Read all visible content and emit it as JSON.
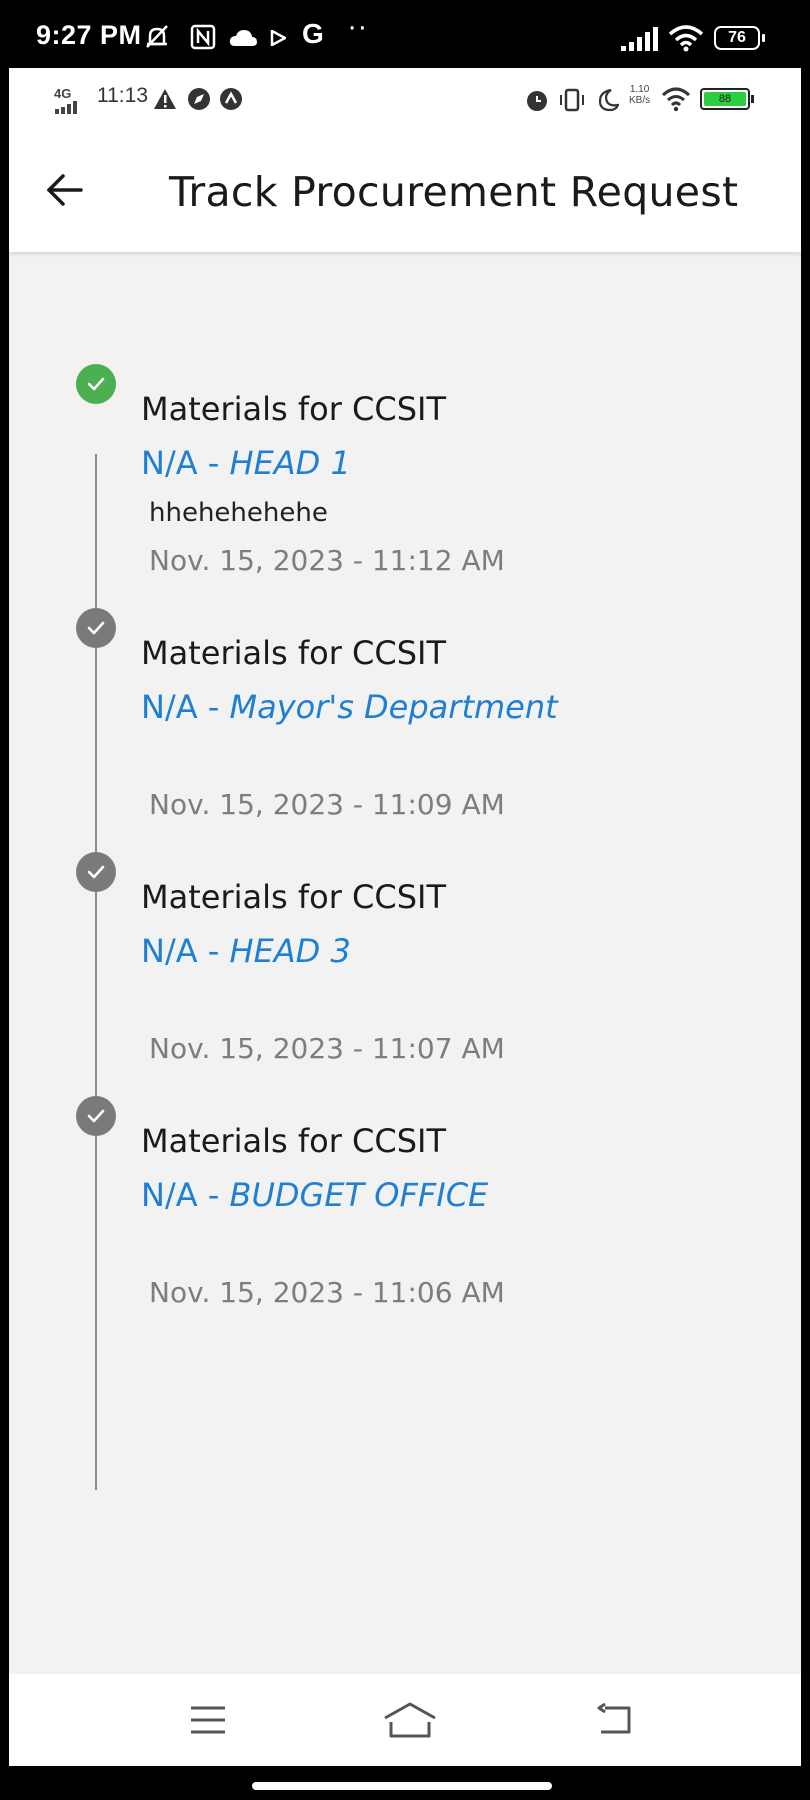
{
  "outer_status": {
    "time": "9:27 PM",
    "g_label": "G",
    "more": "··",
    "battery": "76"
  },
  "inner_status": {
    "network": "4G",
    "time": "11:13",
    "speed_value": "1.10",
    "speed_unit": "KB/s",
    "battery": "88"
  },
  "header": {
    "title": "Track Procurement Request"
  },
  "timeline": [
    {
      "title": "Materials for CCSIT",
      "code": "N/A - ",
      "office": "HEAD 1",
      "remark": "hhehehehehe",
      "date": "Nov. 15, 2023 - 11:12 AM",
      "state": "current",
      "dot_color": "#4caf50"
    },
    {
      "title": "Materials for CCSIT",
      "code": "N/A - ",
      "office": "Mayor's Department",
      "remark": "",
      "date": "Nov. 15, 2023 - 11:09 AM",
      "state": "done",
      "dot_color": "#7a7a7a"
    },
    {
      "title": "Materials for CCSIT",
      "code": "N/A - ",
      "office": "HEAD 3",
      "remark": "",
      "date": "Nov. 15, 2023 - 11:07 AM",
      "state": "done",
      "dot_color": "#7a7a7a"
    },
    {
      "title": "Materials for CCSIT",
      "code": "N/A - ",
      "office": "BUDGET OFFICE",
      "remark": "",
      "date": "Nov. 15, 2023 - 11:06 AM",
      "state": "done",
      "dot_color": "#7a7a7a"
    }
  ],
  "nav": {
    "menu_icon": "menu-icon",
    "home_icon": "home-icon",
    "back_icon": "back-nav-icon"
  },
  "colors": {
    "accent": "#1f7fd2",
    "success": "#4caf50",
    "muted": "#7d7d7d"
  }
}
